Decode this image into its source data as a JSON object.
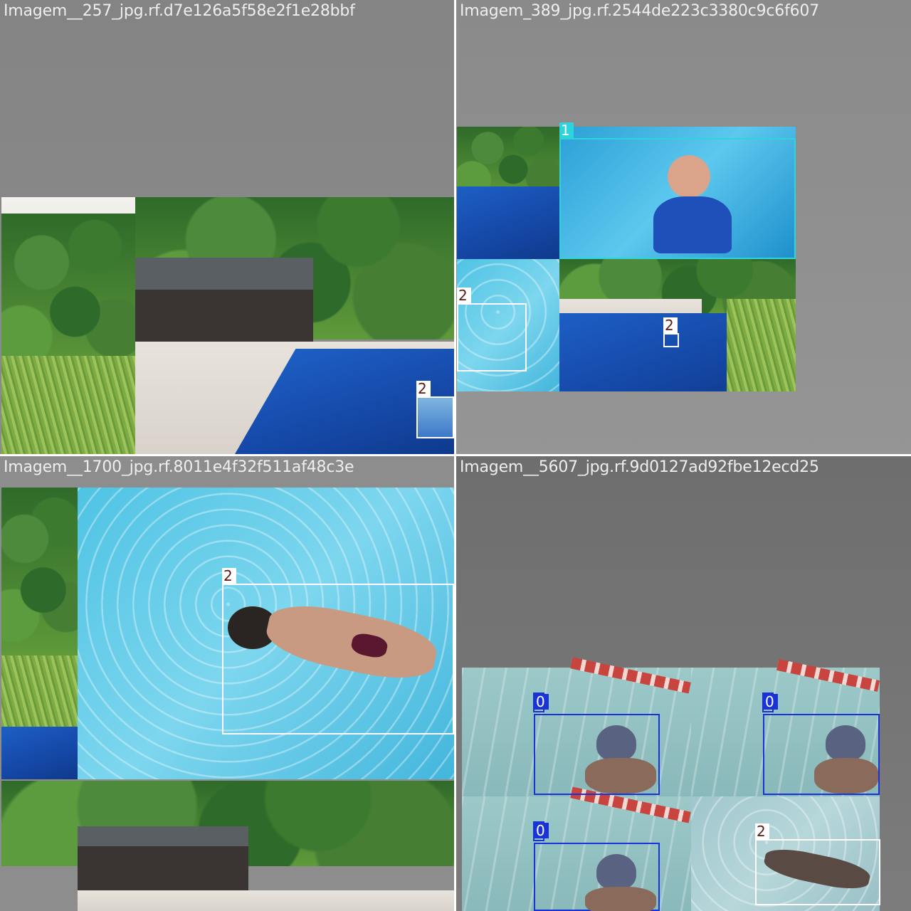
{
  "tiles": [
    {
      "title": "Imagem__257_jpg.rf.d7e126a5f58e2f1e28bbf",
      "labels": [
        "2"
      ]
    },
    {
      "title": "Imagem_389_jpg.rf.2544de223c3380c9c6f607",
      "labels": [
        "1",
        "2",
        "2"
      ]
    },
    {
      "title": "Imagem__1700_jpg.rf.8011e4f32f511af48c3e",
      "labels": [
        "2"
      ]
    },
    {
      "title": "Imagem__5607_jpg.rf.9d0127ad92fbe12ecd25",
      "labels": [
        "0",
        "0",
        "0",
        "2"
      ]
    }
  ],
  "colors": {
    "class_0": "#1a33d6",
    "class_1": "#2fd3dc",
    "class_2": "#ffffff",
    "pad_gray": "#909090"
  }
}
